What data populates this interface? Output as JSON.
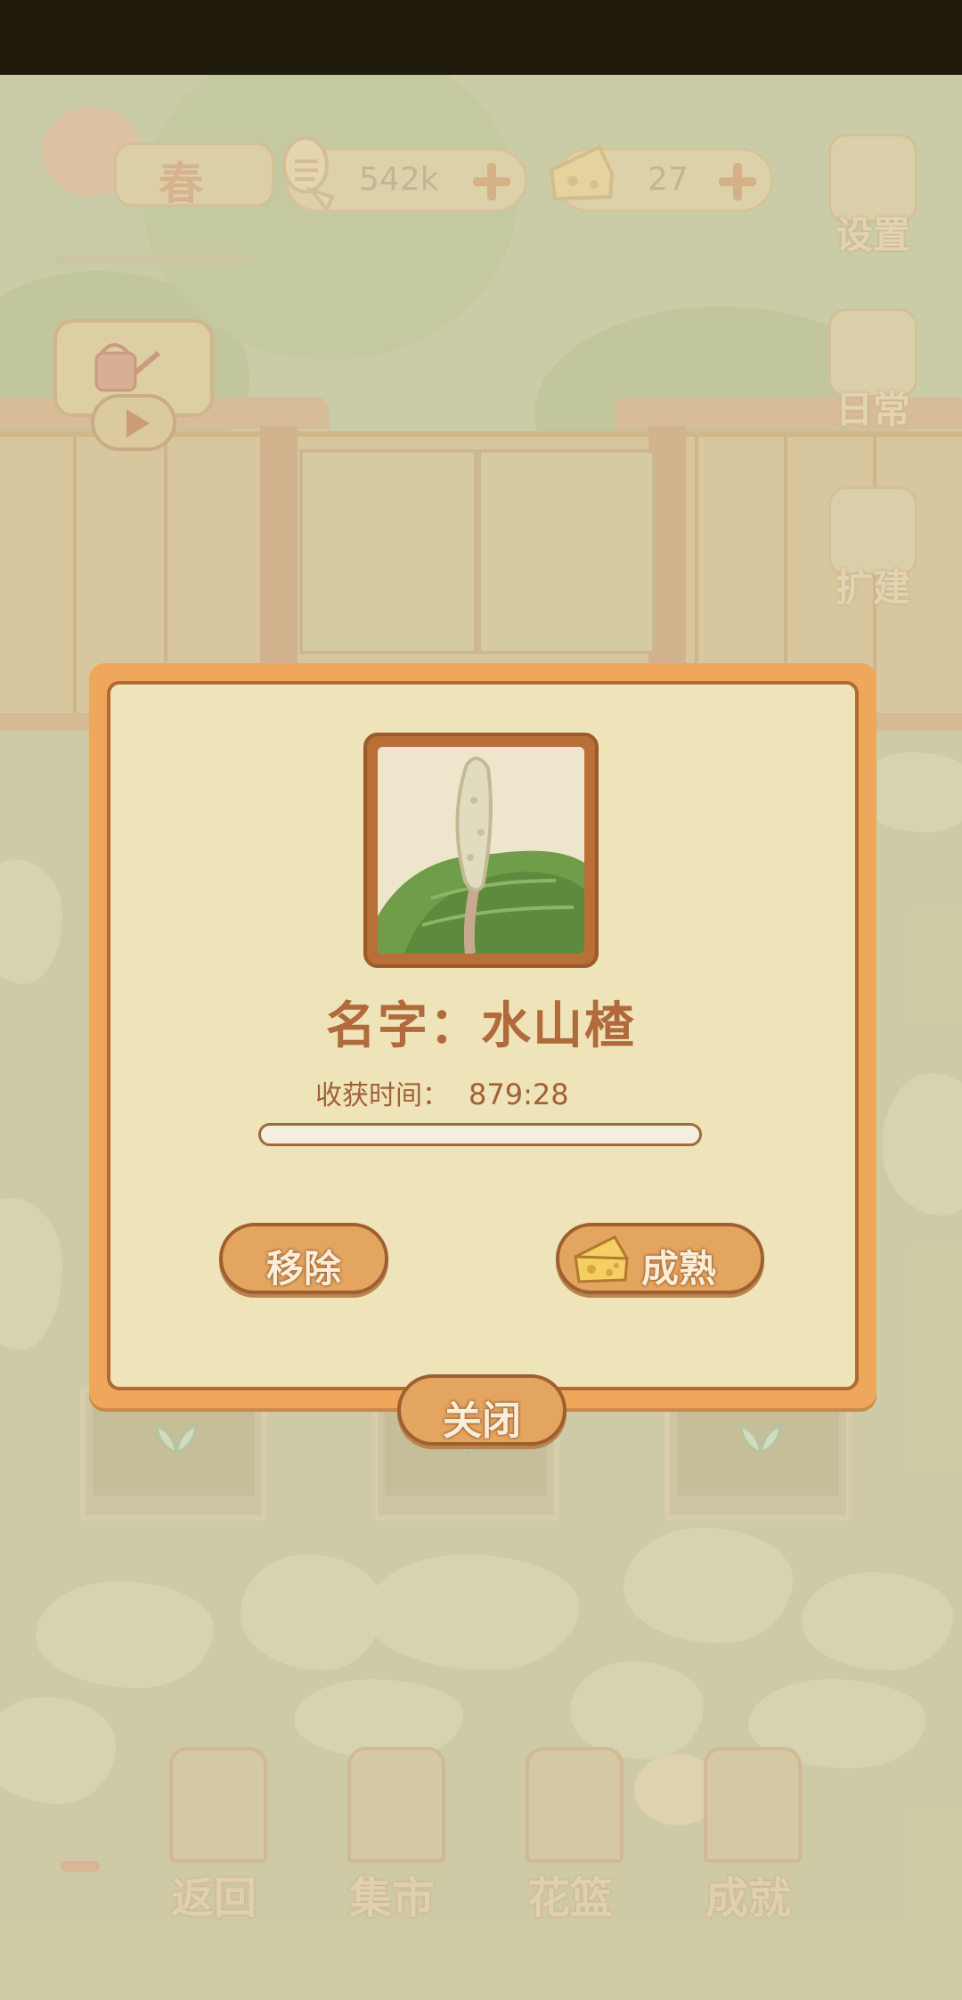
{
  "hud": {
    "season": "春",
    "fish_count": "542k",
    "cheese_count": "27"
  },
  "side_menu": {
    "settings": "设置",
    "daily": "日常",
    "expand": "扩建"
  },
  "dialog": {
    "plant_name": "名字：水山楂",
    "harvest_label": "收获时间：",
    "harvest_time": "879:28",
    "progress": 0.0,
    "remove_label": "移除",
    "ripen_label": "成熟",
    "close_label": "关闭"
  },
  "bottom_nav": {
    "back": "返回",
    "market": "集市",
    "basket": "花篮",
    "achievement": "成就"
  },
  "icons": [
    "fish-bone-icon",
    "cheese-icon",
    "plus-icon",
    "gear-icon",
    "notebook-icon",
    "hammer-icon",
    "watering-can-icon",
    "play-icon",
    "sprout-icon",
    "trophy-icon"
  ],
  "colors": {
    "dialog_border": "#efa85b",
    "dialog_bg": "#efe3b9",
    "button": "#e3a560",
    "text_brown": "#b06a3b"
  }
}
